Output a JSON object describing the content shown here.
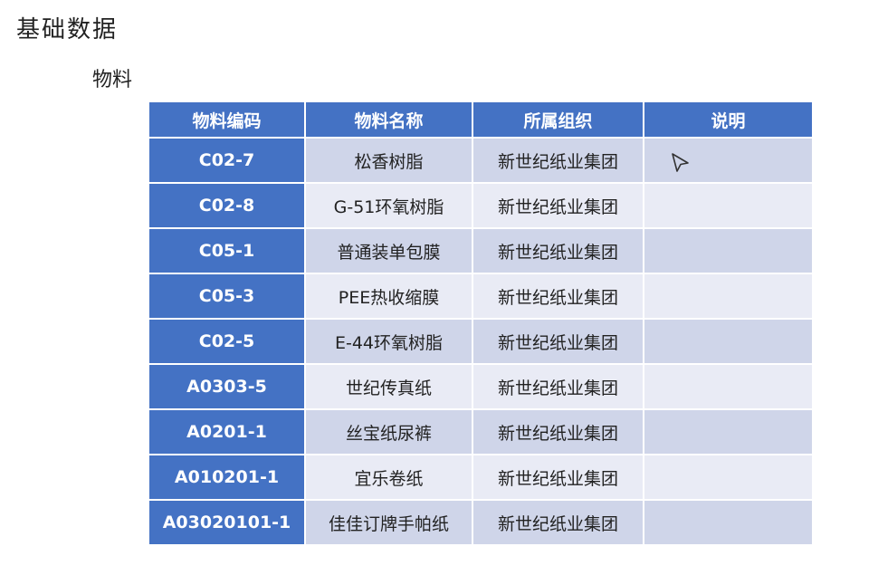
{
  "page": {
    "title": "基础数据",
    "section": "物料"
  },
  "table": {
    "headers": [
      "物料编码",
      "物料名称",
      "所属组织",
      "说明"
    ],
    "rows": [
      {
        "code": "C02-7",
        "name": "松香树脂",
        "org": "新世纪纸业集团",
        "desc": ""
      },
      {
        "code": "C02-8",
        "name": "G-51环氧树脂",
        "org": "新世纪纸业集团",
        "desc": ""
      },
      {
        "code": "C05-1",
        "name": "普通装单包膜",
        "org": "新世纪纸业集团",
        "desc": ""
      },
      {
        "code": "C05-3",
        "name": "PEE热收缩膜",
        "org": "新世纪纸业集团",
        "desc": ""
      },
      {
        "code": "C02-5",
        "name": "E-44环氧树脂",
        "org": "新世纪纸业集团",
        "desc": ""
      },
      {
        "code": "A0303-5",
        "name": "世纪传真纸",
        "org": "新世纪纸业集团",
        "desc": ""
      },
      {
        "code": "A0201-1",
        "name": "丝宝纸尿裤",
        "org": "新世纪纸业集团",
        "desc": ""
      },
      {
        "code": "A010201-1",
        "name": "宜乐卷纸",
        "org": "新世纪纸业集团",
        "desc": ""
      },
      {
        "code": "A03020101-1",
        "name": "佳佳订牌手帕纸",
        "org": "新世纪纸业集团",
        "desc": ""
      }
    ]
  },
  "colors": {
    "header_blue": "#4472c4",
    "row_dark": "#cfd5e9",
    "row_light": "#e9ebf5"
  },
  "icons": {
    "cursor": "mouse-pointer-icon"
  }
}
